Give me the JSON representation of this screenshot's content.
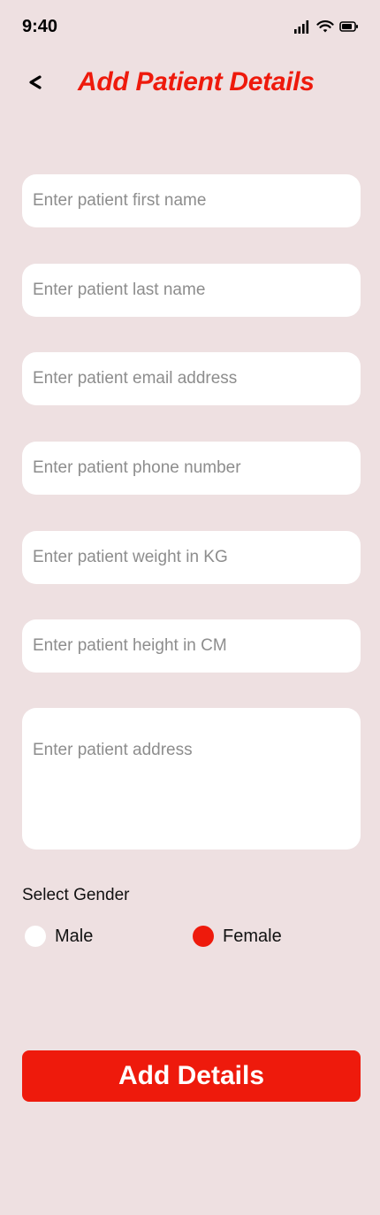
{
  "status_bar": {
    "time": "9:40",
    "icons": [
      "signal-icon",
      "wifi-icon",
      "battery-icon"
    ]
  },
  "header": {
    "back_icon": "chevron-left-icon",
    "title": "Add Patient Details"
  },
  "form": {
    "first_name": {
      "value": "",
      "placeholder": "Enter patient first name"
    },
    "last_name": {
      "value": "",
      "placeholder": "Enter patient last name"
    },
    "email": {
      "value": "",
      "placeholder": "Enter patient email address"
    },
    "phone": {
      "value": "",
      "placeholder": "Enter patient phone number"
    },
    "weight": {
      "value": "",
      "placeholder": "Enter patient weight in KG"
    },
    "height": {
      "value": "",
      "placeholder": "Enter patient height in CM"
    },
    "address": {
      "value": "",
      "placeholder": "Enter patient address"
    }
  },
  "gender": {
    "label": "Select Gender",
    "options": [
      {
        "label": "Male",
        "selected": false
      },
      {
        "label": "Female",
        "selected": true
      }
    ]
  },
  "submit_label": "Add Details",
  "colors": {
    "background": "#EEE0E1",
    "accent": "#EE1A0C",
    "field_bg": "#FFFFFF",
    "placeholder": "#8D8D8D"
  }
}
